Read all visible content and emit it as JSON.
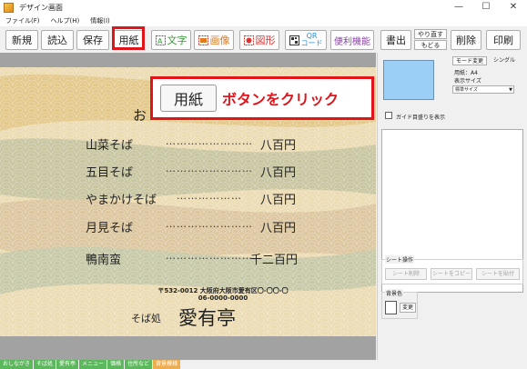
{
  "window": {
    "title": "デザイン画面",
    "controls": {
      "minimize": "—",
      "maximize": "☐",
      "close": "✕"
    }
  },
  "menubar": {
    "items": [
      "ファイル(F)",
      "ヘルプ(H)",
      "情報(I)"
    ]
  },
  "toolbar": {
    "new": "新規",
    "load": "読込",
    "save": "保存",
    "paper": "用紙",
    "text": "文字",
    "image": "画像",
    "shape": "図形",
    "qr_line1": "QR",
    "qr_line2": "コード",
    "convenience": "便利機能",
    "write": "書出",
    "redo": "やり直す",
    "undo": "もどる",
    "delete": "削除",
    "print": "印刷"
  },
  "callout": {
    "button_label": "用紙",
    "text": "ボタンをクリック"
  },
  "document": {
    "title_char": "お",
    "items": [
      {
        "name": "山菜そば",
        "dots": "……………………",
        "price": "八百円"
      },
      {
        "name": "五目そば",
        "dots": "……………………",
        "price": "八百円"
      },
      {
        "name": "やまかけそば",
        "dots": "………………",
        "price": "八百円"
      },
      {
        "name": "月見そば",
        "dots": "……………………",
        "price": "八百円"
      },
      {
        "name": "鴨南蛮",
        "dots": "……………………",
        "price": "千二百円"
      }
    ],
    "address": "〒532-0012 大阪府大阪市愛有区〇-〇〇-〇",
    "phone": "06-0000-0000",
    "shop_prefix": "そば処",
    "shop_name": "愛有亭"
  },
  "bottom_tabs": [
    "おしながき",
    "そば処",
    "愛有亭",
    "メニュー",
    "価格",
    "住所など",
    "背景模様"
  ],
  "right_panel": {
    "mode_change": "モード変更",
    "single": "シングル",
    "paper_label": "用紙：A4",
    "display_size_label": "表示サイズ",
    "display_size_value": "標準サイズ",
    "guide_checkbox": "ガイド目盛りを表示",
    "sheet_ops_label": "シート操作",
    "sheet_delete": "シート削除",
    "sheet_copy": "シートをコピー",
    "sheet_paste": "シートを貼付",
    "bg_color_label": "背景色",
    "change": "変更"
  },
  "colors": {
    "highlight_red": "#e0141b",
    "preview_blue": "#9ccff5",
    "tab_green": "#5cb85c",
    "tab_orange": "#f0ad4e"
  }
}
